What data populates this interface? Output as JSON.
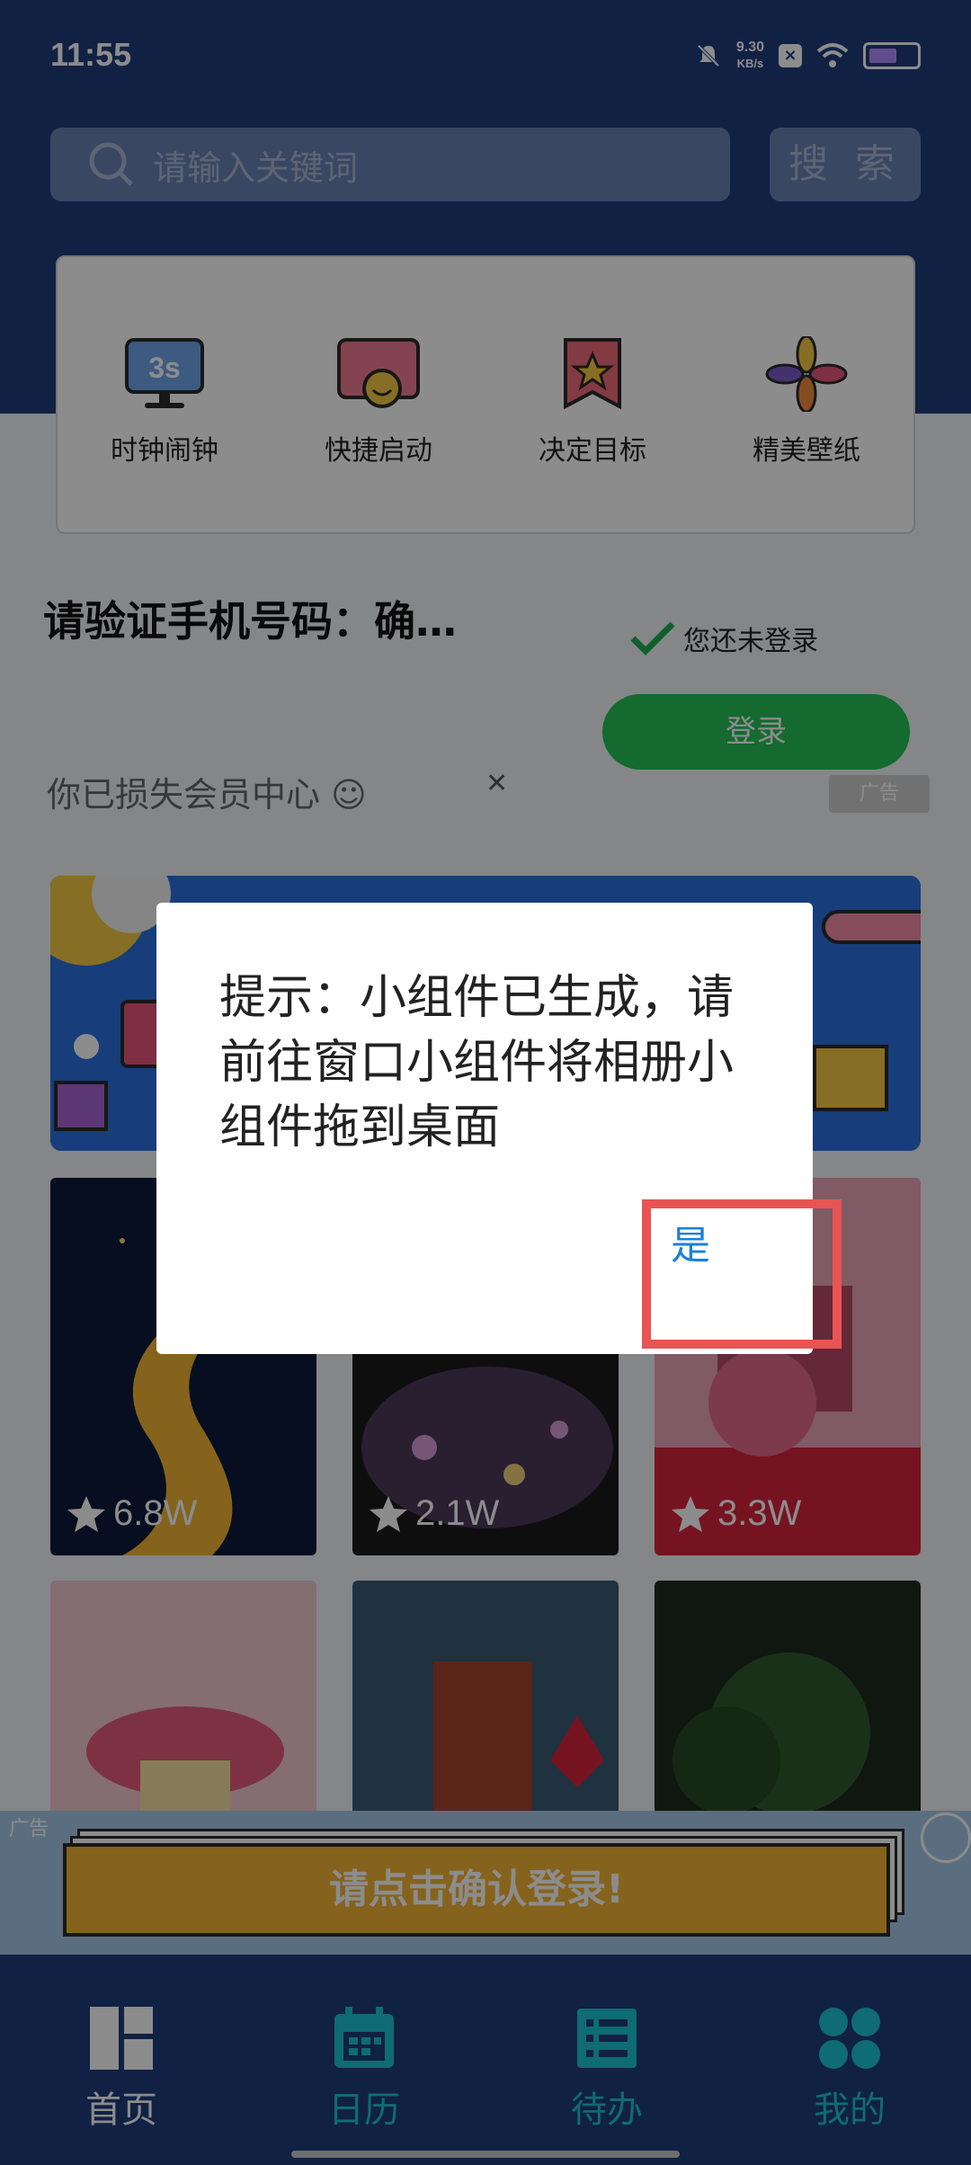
{
  "status_bar": {
    "time": "11:55",
    "net_speed_value": "9.30",
    "net_speed_unit": "KB/s"
  },
  "search": {
    "placeholder": "请输入关键词",
    "button_label": "搜 索"
  },
  "quick_actions": [
    {
      "label": "时钟闹钟",
      "icon": "monitor-3s-icon"
    },
    {
      "label": "快捷启动",
      "icon": "smiley-card-icon"
    },
    {
      "label": "决定目标",
      "icon": "star-flag-icon"
    },
    {
      "label": "精美壁纸",
      "icon": "pinwheel-icon"
    }
  ],
  "verify": {
    "title": "请验证手机号码：确…",
    "login_status": "您还未登录",
    "login_button": "登录"
  },
  "member_banner": {
    "text": "你已损失会员中心 ☺",
    "ad_badge": "广告"
  },
  "wallpapers": [
    {
      "count": "6.8W"
    },
    {
      "count": "2.1W"
    },
    {
      "count": "3.3W"
    }
  ],
  "bottom_ad": {
    "label": "广告",
    "cta": "请点击确认登录!"
  },
  "tabbar": [
    {
      "label": "首页",
      "color": "#ffffff"
    },
    {
      "label": "日历",
      "color": "#1cc3d6"
    },
    {
      "label": "待办",
      "color": "#1cc3d6"
    },
    {
      "label": "我的",
      "color": "#1cc3d6"
    }
  ],
  "dialog": {
    "message": "提示：小组件已生成，请前往窗口小组件将相册小组件拖到桌面",
    "confirm": "是"
  },
  "colors": {
    "primary": "#1f3c7c",
    "accent": "#1cc3d6",
    "login_green": "#26c256",
    "highlight": "#e85454"
  }
}
